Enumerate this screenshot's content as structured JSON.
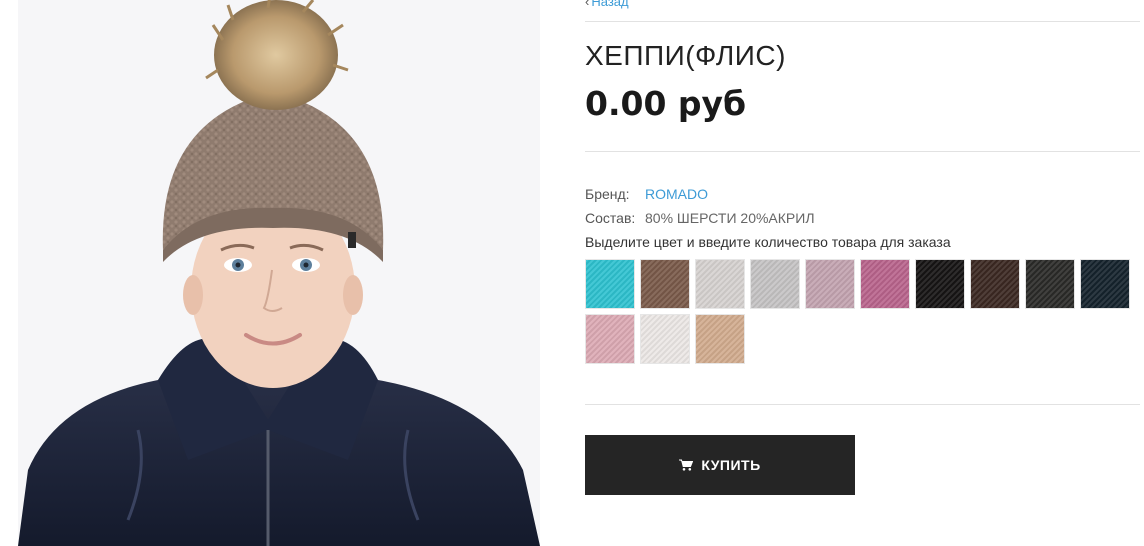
{
  "nav": {
    "back_label": "Назад",
    "back_icon": "chevron-left-icon"
  },
  "product": {
    "title": "ХЕППИ(ФЛИС)",
    "price": "0.00 руб",
    "brand_label": "Бренд:",
    "brand_value": "ROMADO",
    "composition_label": "Состав:",
    "composition_value": "80% ШЕРСТИ 20%АКРИЛ",
    "color_hint": "Выделите цвет и введите количество товара для заказа"
  },
  "swatches": [
    {
      "color": "#2fc2d0"
    },
    {
      "color": "#7a5a4a"
    },
    {
      "color": "#d6d2d0"
    },
    {
      "color": "#c5c3c4"
    },
    {
      "color": "#c3a4b0"
    },
    {
      "color": "#b9648c"
    },
    {
      "color": "#161414"
    },
    {
      "color": "#3b2822"
    },
    {
      "color": "#2b2a28"
    },
    {
      "color": "#15232d"
    },
    {
      "color": "#dcaab4"
    },
    {
      "color": "#ece8e6"
    },
    {
      "color": "#d2ac8e"
    }
  ],
  "buy_button": {
    "label": "КУПИТЬ",
    "icon": "cart-icon"
  },
  "colors": {
    "link": "#3d9bd6",
    "button_bg": "#252525"
  }
}
